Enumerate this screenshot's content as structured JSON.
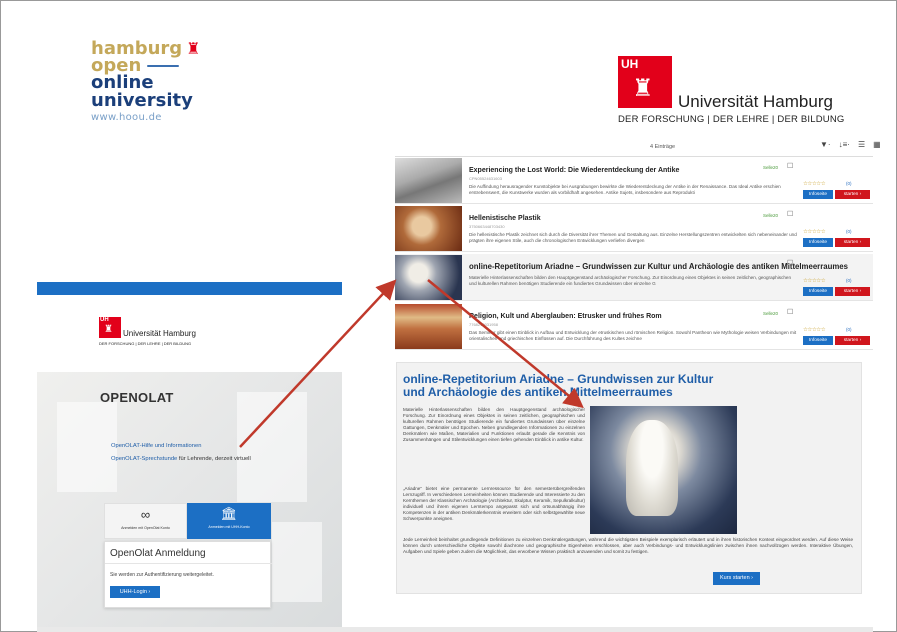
{
  "hoou_logo": {
    "line1": "hamburg",
    "line2": "open",
    "line3": "online",
    "line4": "university",
    "url": "www.hoou.de"
  },
  "uhh_logo": {
    "mark": "UH",
    "name": "Universität Hamburg",
    "tagline": "DER FORSCHUNG | DER LEHRE | DER BILDUNG"
  },
  "catalog": {
    "count": "4 Einträge",
    "tools": [
      "▼·",
      "↓≡·",
      "☰",
      "▦"
    ],
    "items": [
      {
        "title": "Experiencing the Lost World: Die Wiederentdeckung der Antike",
        "id": "CPN05524631603",
        "desc": "Die Auffindung herausragender Kunstobjekte bei Ausgrabungen bewirkte die Wiederentdeckung der Antike in der Renaissance. Das Ideal Antike erschien erstrebenswert, die Kunstwerke wurden als vorbildhaft angesehen. Antike Sujets, insbesondere aus Reprodukti",
        "badge": "Selle20",
        "stars": "☆☆☆☆☆",
        "comments": "(0)",
        "info": "Infoseite",
        "start": "starten"
      },
      {
        "title": "Hellenistische Plastik",
        "id": "3750663448703430",
        "desc": "Die hellenistische Plastik zeichnet sich durch die Diversität ihrer Themen und Gestaltung aus. Einzelne Herstellungszentren entwickelten sich nebeneinander und prägten ihre eigenen Stile, auch die chronologischen Entwicklungen verliefen divergen",
        "badge": "Selle20",
        "stars": "☆☆☆☆☆",
        "comments": "(0)",
        "info": "Infoseite",
        "start": "starten"
      },
      {
        "title": "online-Repetitorium Ariadne – Grundwissen zur Kultur und Archäologie des antiken Mittelmeerraumes",
        "desc": "Materielle Hinterlassenschaften bilden den Hauptgegenstand archäologischer Forschung. Zur Einordnung eines Objektes in seinen zeitlichen, geographischen und kulturellen Rahmen benötigen Studierende ein fundiertes Grundwissen über einzelne G",
        "stars": "☆☆☆☆☆",
        "comments": "(0)",
        "info": "Infoseite",
        "start": "starten"
      },
      {
        "title": "Religion, Kult und Aberglauben: Etrusker und frühes Rom",
        "id": "7768210031958",
        "desc": "Das Seminar gibt einen Einblick in Aufbau und Entwicklung der etruskischen und römischen Religion. Sowohl Pantheon wie Mythologie weisen Verbindungen mit orientalischen und griechischen Einflüssen auf. Die Durchführung des Kultes zeichne",
        "badge": "Selle20",
        "stars": "☆☆☆☆☆",
        "comments": "(0)",
        "info": "Infoseite",
        "start": "starten"
      }
    ]
  },
  "detail": {
    "title": "online-Repetitorium Ariadne – Grundwissen zur Kultur und Archäologie des antiken Mittelmeerraumes",
    "p1": "Materielle Hinterlassenschaften bilden den Hauptgegenstand archäologischer Forschung. Zur Einordnung eines Objektes in seinen zeitlichen, geographischen und kulturellen Rahmen benötigen Studierende ein fundiertes Grundwissen über einzelne Gattungen, Denkmäler und Epochen. Neben grundlegenden Informationen zu einzelnen Denkmälern wie Maßen, Materialien und Funktionen erlaubt gerade die Kenntnis von Zusammenhängen und Stilentwicklungen einen tiefen gehenden Einblick in antike Kultur.",
    "p2": "„Ariadne“ bietet eine permanente Lernressource für den semesterübergreifenden Lernzugriff. In verschiedenen Lerneinheiten können Studierende und Interessierte zu den Kernthemen der Klassischen Archäologie (Architektur, Skulptur, Keramik, Sepulkralkultur) individuell und ihrem eigenen Lerntempo angepasst sich und ortsunabhängig ihre Kompetenzen in der antiken Denkmälerkenntnis erweitern oder sich selbstgewählte neue Schwerpunkte aneignen.",
    "p3": "Jede Lerneinheit beinhaltet grundlegende Definitionen zu einzelnen Denkmälergattungen, während die wichtigsten Beispiele exemplarisch erläutert und in ihren historischen Kontext eingeordnet werden. Auf diese Weise können durch unterschiedliche Objekte sowohl diachrone und geographische Eigenheiten erschlossen, aber auch Verbindungs- und Entwicklungslinien zwischen ihnen nachvollzogen werden. Interaktive Übungen, Aufgaben und Spiele geben zudem die Möglichkeit, das erworbene Wissen praktisch anzuwenden und somit zu festigen.",
    "button": "Kurs starten"
  },
  "openolat": {
    "uhh_mark": "UH",
    "uhh_name": "Universität Hamburg",
    "uhh_tagline": "DER FORSCHUNG | DER LEHRE | DER BILDUNG",
    "heading": "OPENOLAT",
    "link1": "OpenOLAT-Hilfe und Informationen",
    "link2_link": "OpenOLAT-Sprechstunde",
    "link2_rest": " für Lehrende, derzeit virtuell",
    "tile1_icon": "∞",
    "tile1_label": "Anmelden mit OpenOlat Konto",
    "tile2_label": "Anmelden mit UHH-Konto",
    "login_title": "OpenOlat Anmeldung",
    "login_text": "Sie werden zur Authentifizierung weitergeleitet.",
    "login_button": "UHH-Login"
  },
  "colors": {
    "uhh_red": "#e2001a",
    "accent_blue": "#1c6fc4",
    "start_red": "#d0161d",
    "arrow_red": "#c0392b"
  }
}
